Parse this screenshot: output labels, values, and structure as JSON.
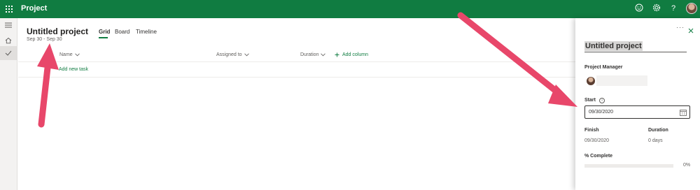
{
  "app": {
    "name": "Project"
  },
  "topbar": {
    "icons": [
      "waffle-icon",
      "feedback-smiley-icon",
      "settings-gear-icon",
      "help-icon"
    ]
  },
  "rail": {
    "icons": [
      "hamburger-icon",
      "home-icon",
      "checkmark-icon"
    ]
  },
  "project": {
    "title": "Untitled project",
    "dates": "Sep 30 - Sep 30"
  },
  "tabs": [
    {
      "label": "Grid",
      "active": true
    },
    {
      "label": "Board",
      "active": false
    },
    {
      "label": "Timeline",
      "active": false
    }
  ],
  "grid": {
    "columns": [
      "Name",
      "Assigned to",
      "Duration"
    ],
    "add_column_label": "Add column",
    "add_task_label": "Add new task"
  },
  "panel": {
    "title": "Untitled project",
    "manager_label": "Project Manager",
    "start_label": "Start",
    "start_value": "09/30/2020",
    "finish_label": "Finish",
    "finish_value": "09/30/2020",
    "duration_label": "Duration",
    "duration_value": "0 days",
    "complete_label": "% Complete",
    "complete_value": "0%",
    "complete_fraction": 0
  },
  "colors": {
    "brand": "#107c41",
    "annotation_arrow": "#e8476a"
  }
}
